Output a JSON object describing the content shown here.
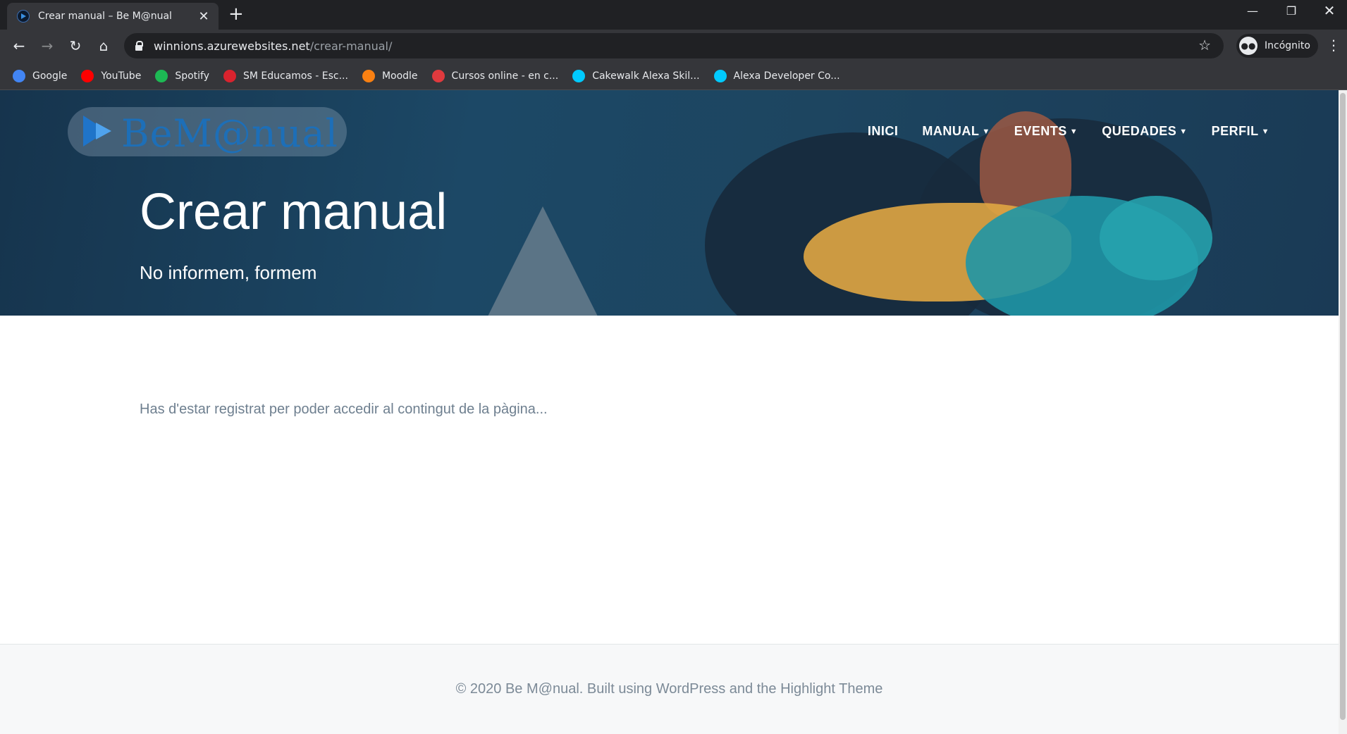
{
  "browser": {
    "tab_title": "Crear manual – Be M@nual",
    "new_tab_label": "+",
    "url_host": "winnions.azurewebsites.net",
    "url_path": "/crear-manual/",
    "profile_label": "Incógnito",
    "bookmarks": [
      {
        "label": "Google",
        "icon": "google-icon",
        "color": "#4285f4"
      },
      {
        "label": "YouTube",
        "icon": "youtube-icon",
        "color": "#ff0000"
      },
      {
        "label": "Spotify",
        "icon": "spotify-icon",
        "color": "#1db954"
      },
      {
        "label": "SM Educamos - Esc...",
        "icon": "sm-educamos-icon",
        "color": "#d9232e"
      },
      {
        "label": "Moodle",
        "icon": "moodle-icon",
        "color": "#f98012"
      },
      {
        "label": "Cursos online - en c...",
        "icon": "cursos-icon",
        "color": "#e03a3e"
      },
      {
        "label": "Cakewalk Alexa Skil...",
        "icon": "alexa-icon",
        "color": "#00caff"
      },
      {
        "label": "Alexa Developer Co...",
        "icon": "alexa-icon",
        "color": "#00caff"
      }
    ]
  },
  "site": {
    "logo_text": "BeM@nual",
    "nav": [
      {
        "label": "INICI",
        "dropdown": false
      },
      {
        "label": "MANUAL",
        "dropdown": true
      },
      {
        "label": "EVENTS",
        "dropdown": true
      },
      {
        "label": "QUEDADES",
        "dropdown": true
      },
      {
        "label": "PERFIL",
        "dropdown": true
      }
    ],
    "hero_title": "Crear manual",
    "hero_subtitle": "No informem, formem",
    "notice": "Has d'estar registrat per poder accedir al contingut de la pàgina...",
    "footer": "©  2020 Be M@nual. Built using WordPress and the Highlight Theme"
  }
}
